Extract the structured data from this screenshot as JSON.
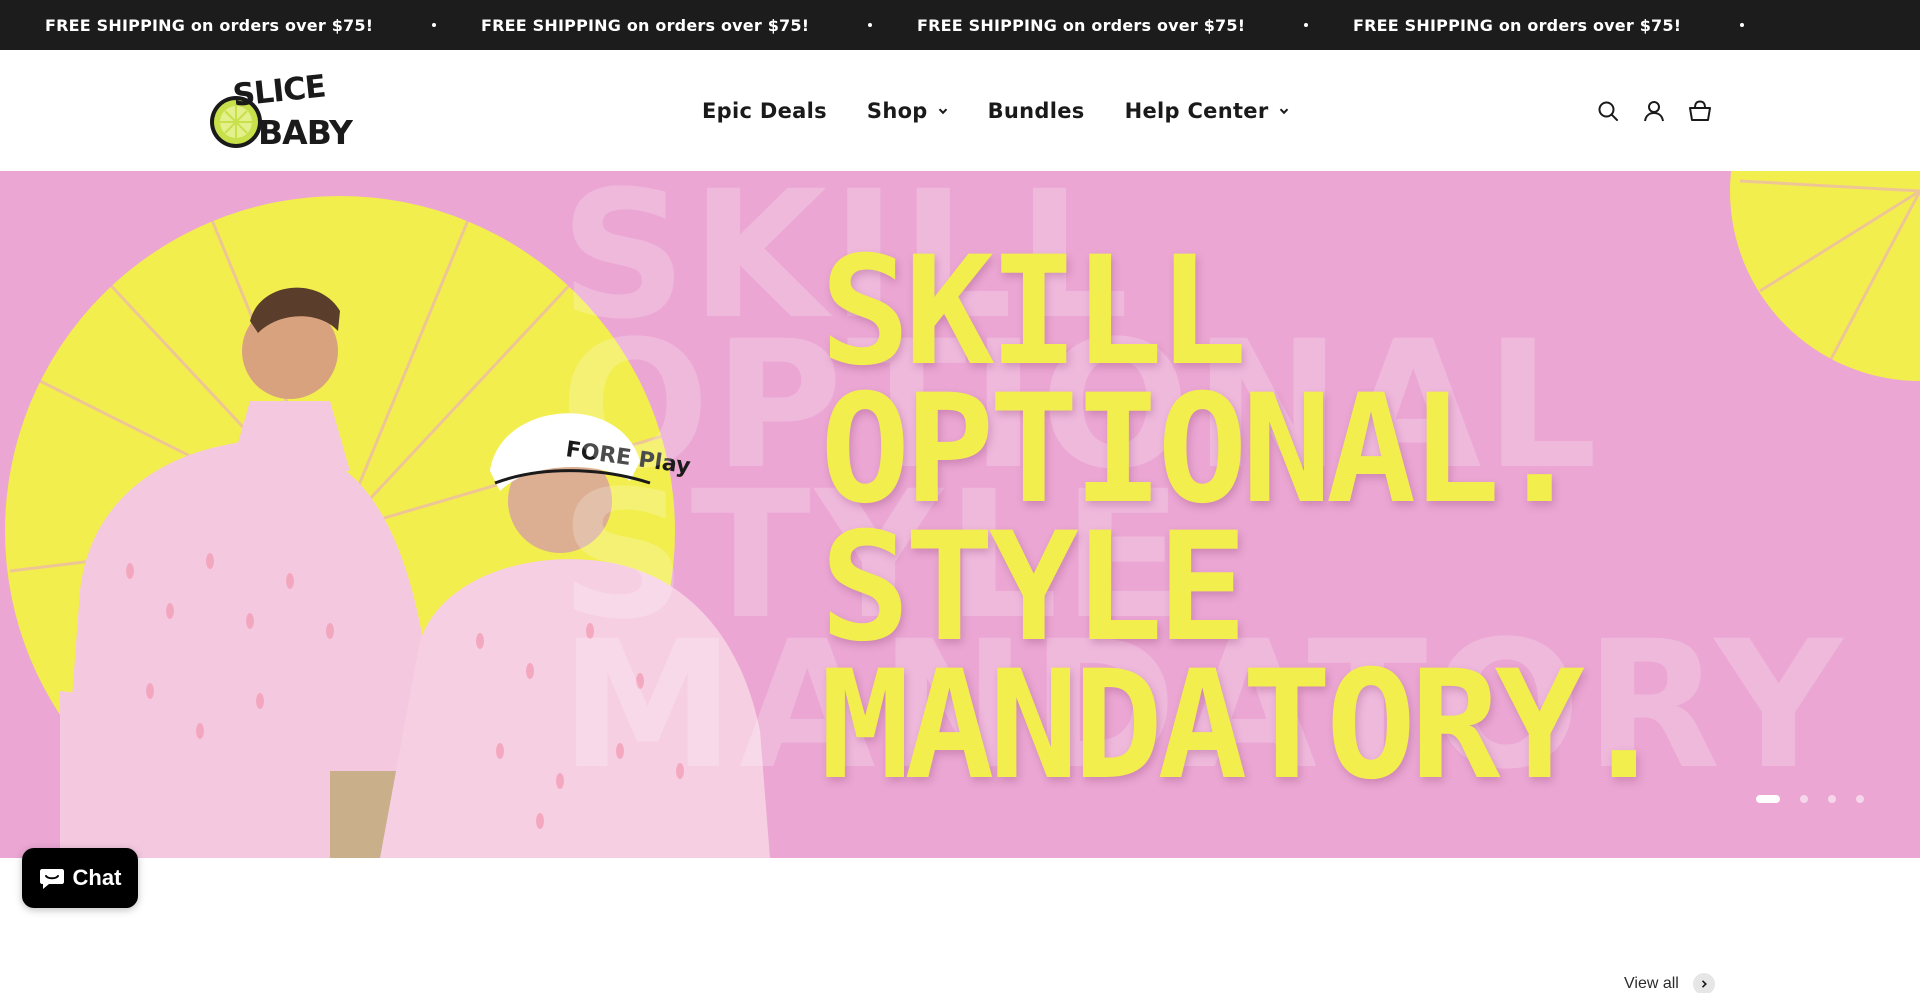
{
  "announcement": {
    "messages": [
      "FREE SHIPPING on orders over $75!",
      "FREE SHIPPING on orders over $75!",
      "FREE SHIPPING on orders over $75!",
      "FREE SHIPPING on orders over $75!"
    ],
    "background": "#1c1c1c"
  },
  "header": {
    "logo_text": [
      "SLICE",
      "BABY"
    ],
    "nav": [
      {
        "label": "Epic Deals",
        "has_dropdown": false
      },
      {
        "label": "Shop",
        "has_dropdown": true
      },
      {
        "label": "Bundles",
        "has_dropdown": false
      },
      {
        "label": "Help Center",
        "has_dropdown": true
      }
    ],
    "icons": [
      "search-icon",
      "account-icon",
      "cart-icon"
    ]
  },
  "hero": {
    "headline": [
      "SKILL",
      "OPTIONAL.",
      "STYLE",
      "MANDATORY."
    ],
    "ghost_text": [
      "SKILL",
      "OPTIONAL",
      "STYLE",
      "MANDATORY"
    ],
    "cap_text": "FORE Play",
    "background": "#eba6d3",
    "accent": "#f2ee4d",
    "slides": {
      "current": 1,
      "total": 4
    }
  },
  "chat": {
    "label": "Chat",
    "icon": "chat-bubble-icon"
  },
  "collection": {
    "view_all": "View all"
  }
}
